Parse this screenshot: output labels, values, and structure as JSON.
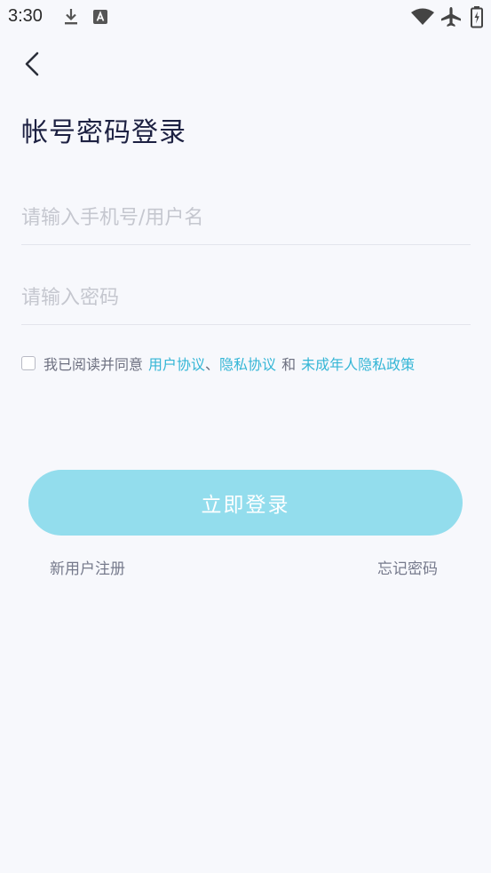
{
  "status_bar": {
    "time": "3:30",
    "icons": [
      "download-icon",
      "font-a-icon",
      "wifi-icon",
      "airplane-mode-icon",
      "battery-charging-icon"
    ]
  },
  "header": {
    "back_icon": "chevron-left-icon",
    "title": "帐号密码登录"
  },
  "form": {
    "username_placeholder": "请输入手机号/用户名",
    "username_value": "",
    "password_placeholder": "请输入密码",
    "password_value": ""
  },
  "agreement": {
    "checked": false,
    "prefix": "我已阅读并同意",
    "user_agreement": "用户协议",
    "separator": "、",
    "privacy_agreement": "隐私协议",
    "conjunction": "和",
    "minor_privacy_policy": "未成年人隐私政策"
  },
  "actions": {
    "login_label": "立即登录",
    "register_label": "新用户注册",
    "forgot_password_label": "忘记密码"
  },
  "colors": {
    "background": "#f7f8fc",
    "accent": "#35b6d6",
    "button": "#93dded",
    "title": "#1d2142"
  }
}
